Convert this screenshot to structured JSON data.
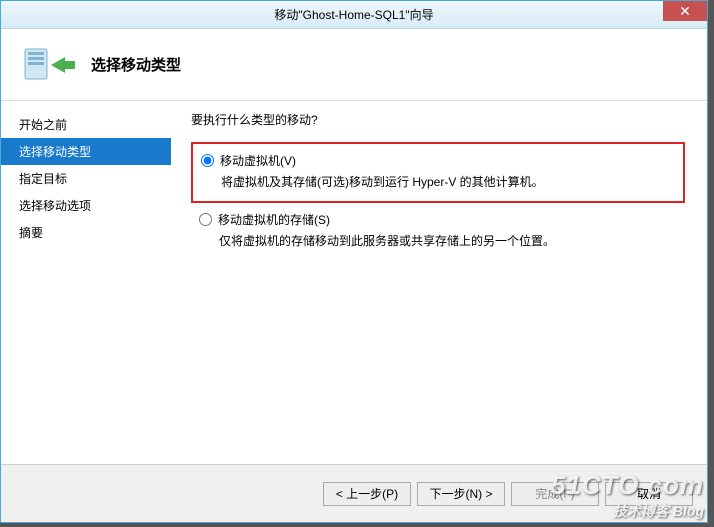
{
  "titlebar": {
    "title": "移动\"Ghost-Home-SQL1\"向导"
  },
  "header": {
    "title": "选择移动类型"
  },
  "sidebar": {
    "items": [
      {
        "label": "开始之前",
        "active": false
      },
      {
        "label": "选择移动类型",
        "active": true
      },
      {
        "label": "指定目标",
        "active": false
      },
      {
        "label": "选择移动选项",
        "active": false
      },
      {
        "label": "摘要",
        "active": false
      }
    ]
  },
  "content": {
    "question": "要执行什么类型的移动?",
    "options": [
      {
        "label": "移动虚拟机(V)",
        "desc": "将虚拟机及其存储(可选)移动到运行 Hyper-V 的其他计算机。",
        "checked": true,
        "highlighted": true
      },
      {
        "label": "移动虚拟机的存储(S)",
        "desc": "仅将虚拟机的存储移动到此服务器或共享存储上的另一个位置。",
        "checked": false,
        "highlighted": false
      }
    ]
  },
  "footer": {
    "prev": "< 上一步(P)",
    "next": "下一步(N) >",
    "finish": "完成(F)",
    "cancel": "取消"
  },
  "watermark": {
    "line1": "51CTO.com",
    "line2": "技术博客 Blog"
  }
}
